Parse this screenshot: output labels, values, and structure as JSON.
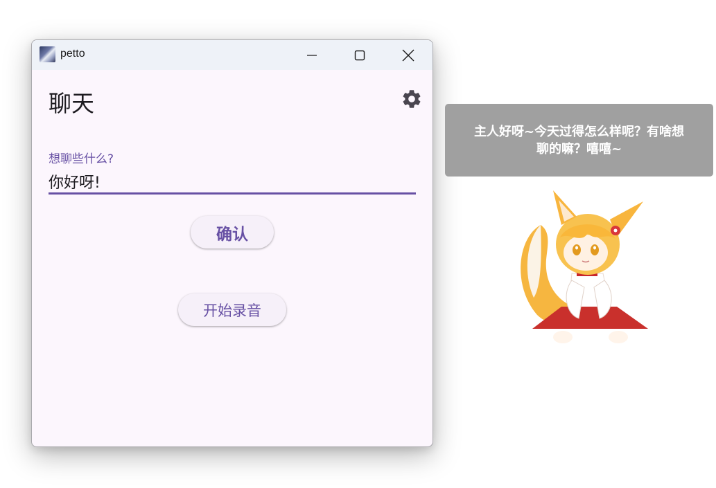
{
  "window": {
    "app_title": "petto",
    "app_icon": "anime-avatar-icon",
    "controls": {
      "minimize": "minimize-icon",
      "maximize": "maximize-icon",
      "close": "close-icon"
    }
  },
  "page": {
    "title": "聊天",
    "settings_icon": "gear-icon"
  },
  "chat_input": {
    "label": "想聊些什么?",
    "value": "你好呀!",
    "accent_color": "#6750a4"
  },
  "buttons": {
    "confirm_label": "确认",
    "record_label": "开始录音"
  },
  "pet": {
    "speech": "主人好呀~今天过得怎么样呢？有啥想聊的嘛？嘻嘻~",
    "character": "fox-girl-mascot"
  }
}
